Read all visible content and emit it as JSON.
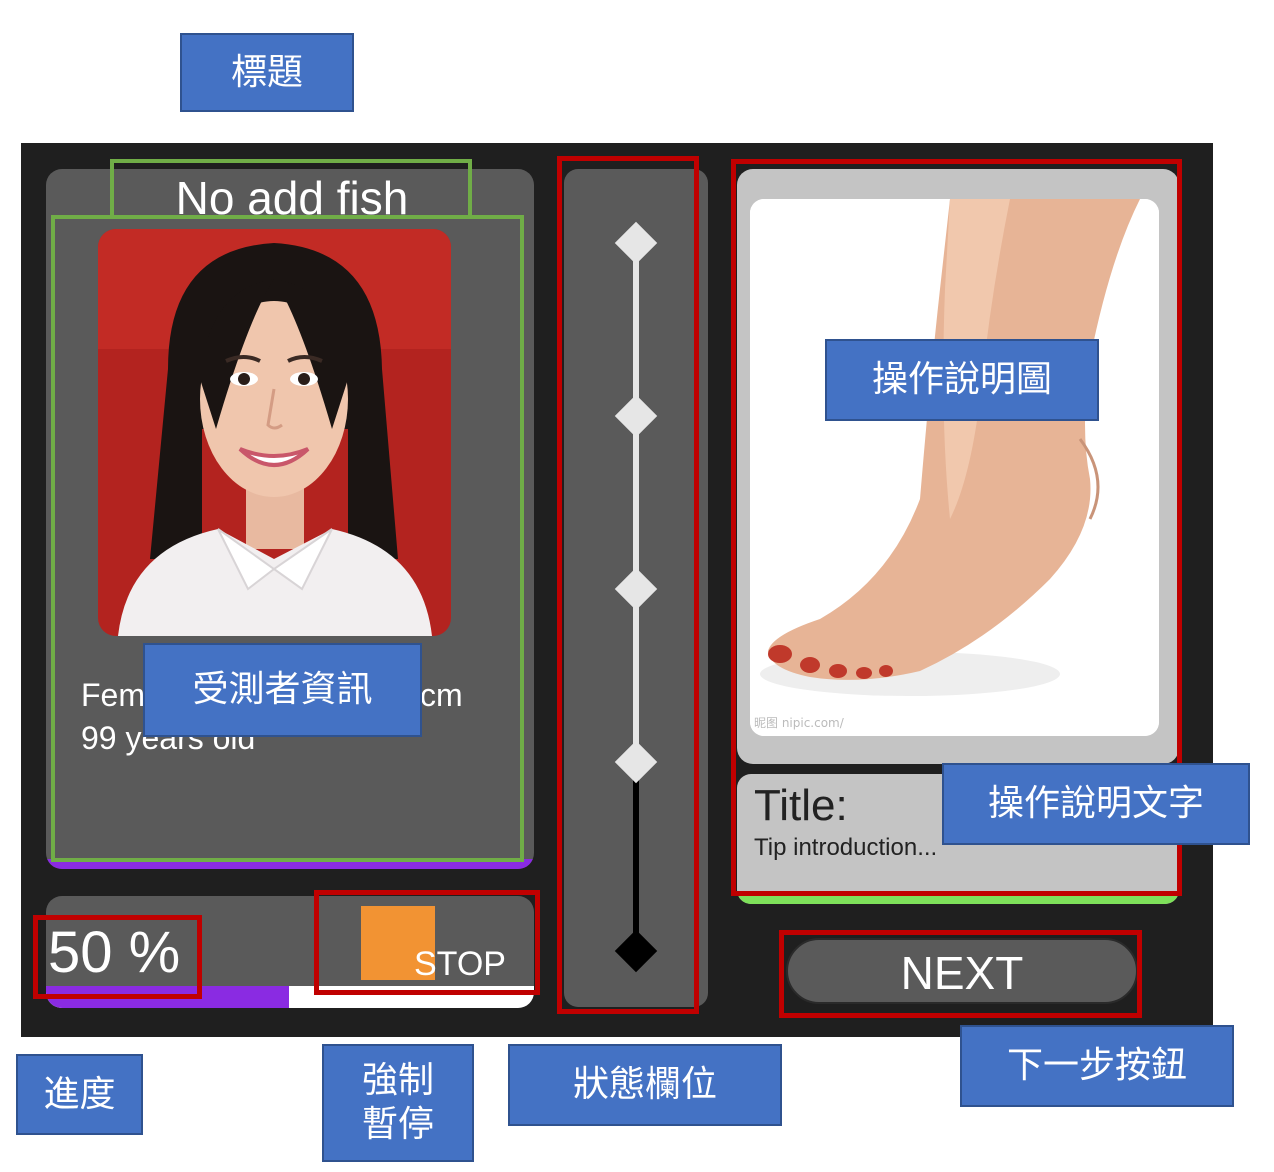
{
  "colors": {
    "frame_bg": "#1f1f1f",
    "panel_bg": "#5a5a5a",
    "card_light": "#c4c4c4",
    "accent_purple": "#8a2be2",
    "accent_green": "#7ee05a",
    "stop_orange": "#f29333",
    "annotation_blue": "#4472c4",
    "outline_green": "#70ad47",
    "outline_red": "#c00000"
  },
  "profile": {
    "title": "No add fish",
    "photo_icon": "portrait-photo",
    "info_line_1_start": "Fem",
    "info_line_1_end": "cm",
    "info_line_2": "99 years old"
  },
  "progress": {
    "text": "50 %",
    "value_percent": 50
  },
  "stop_button": {
    "label": "STOP"
  },
  "status": {
    "step_count": 5,
    "completed_steps": 4
  },
  "instruction": {
    "image_icon": "foot-photo",
    "watermark": "昵图 nipic.com/",
    "tip_title": "Title:",
    "tip_text": "Tip introduction..."
  },
  "next_button": {
    "label": "NEXT"
  },
  "annotations": {
    "title": "標題",
    "subject_info": "受測者資訊",
    "instruction_image": "操作說明圖",
    "instruction_text": "操作說明文字",
    "progress": "進度",
    "force_pause": "強制\n暫停",
    "status_field": "狀態欄位",
    "next_button": "下一步按鈕"
  }
}
